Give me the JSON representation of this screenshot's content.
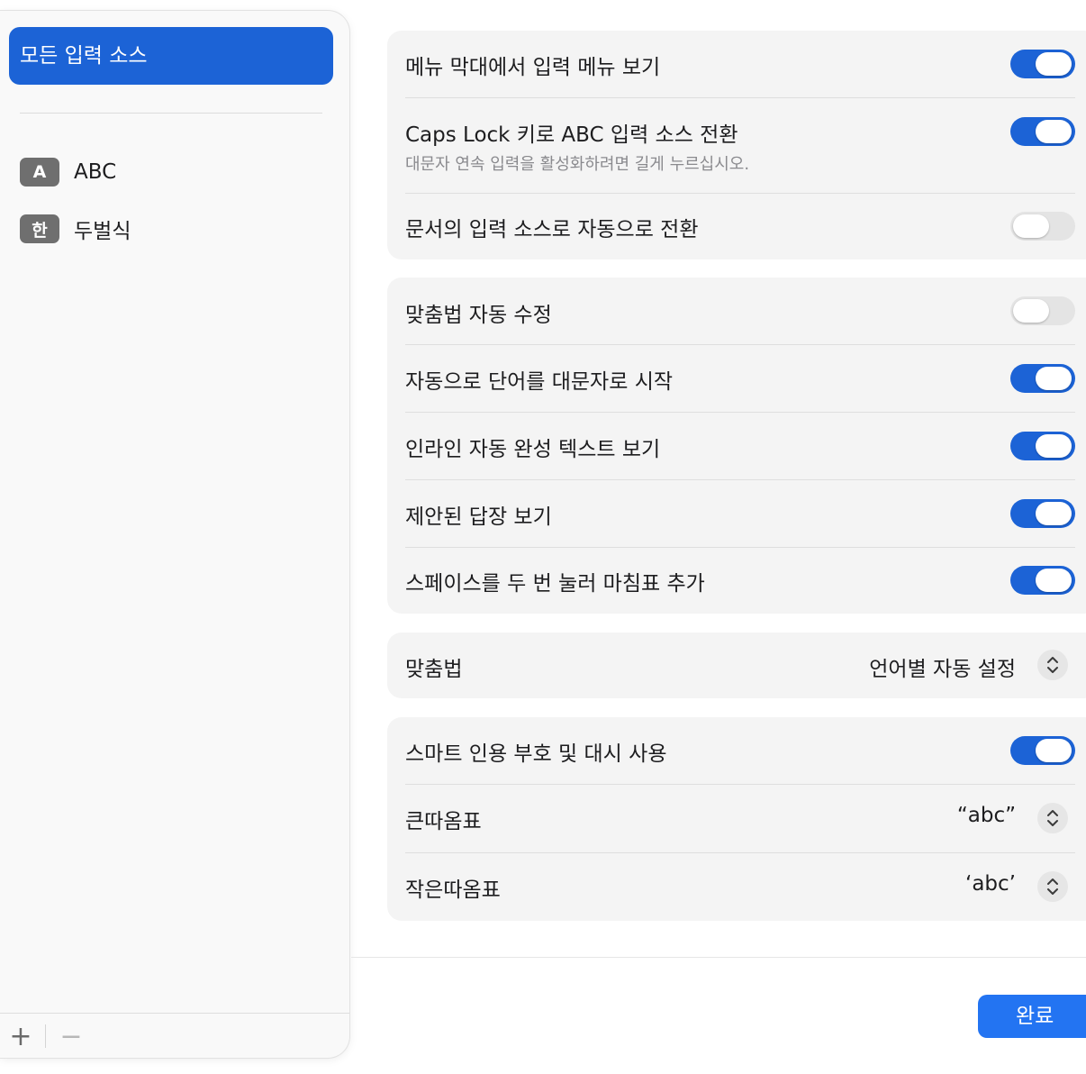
{
  "sidebar": {
    "selected_label": "모든 입력 소스",
    "items": [
      {
        "badge": "A",
        "label": "ABC"
      },
      {
        "badge": "한",
        "label": "두벌식"
      }
    ],
    "add_label": "+",
    "remove_label": "−"
  },
  "group1": {
    "rows": [
      {
        "label": "메뉴 막대에서 입력 메뉴 보기",
        "toggle": true
      },
      {
        "label": "Caps Lock 키로 ABC 입력 소스 전환",
        "sublabel": "대문자 연속 입력을 활성화하려면 길게 누르십시오.",
        "toggle": true
      },
      {
        "label": "문서의 입력 소스로 자동으로 전환",
        "toggle": false
      }
    ]
  },
  "group2": {
    "rows": [
      {
        "label": "맞춤법 자동 수정",
        "toggle": false
      },
      {
        "label": "자동으로 단어를 대문자로 시작",
        "toggle": true
      },
      {
        "label": "인라인 자동 완성 텍스트 보기",
        "toggle": true
      },
      {
        "label": "제안된 답장 보기",
        "toggle": true
      },
      {
        "label": "스페이스를 두 번 눌러 마침표 추가",
        "toggle": true
      }
    ]
  },
  "group3": {
    "label": "맞춤법",
    "value": "언어별 자동 설정"
  },
  "group4": {
    "smart_quotes_label": "스마트 인용 부호 및 대시 사용",
    "smart_quotes_toggle": true,
    "double_quotes_label": "큰따옴표",
    "double_quotes_value": "“abc”",
    "single_quotes_label": "작은따옴표",
    "single_quotes_value": "‘abc’"
  },
  "footer": {
    "done_label": "완료"
  },
  "colors": {
    "accent": "#1c63d6",
    "done_button": "#2374f2",
    "toggle_off": "#e4e4e4",
    "card_bg": "#f4f4f4"
  }
}
